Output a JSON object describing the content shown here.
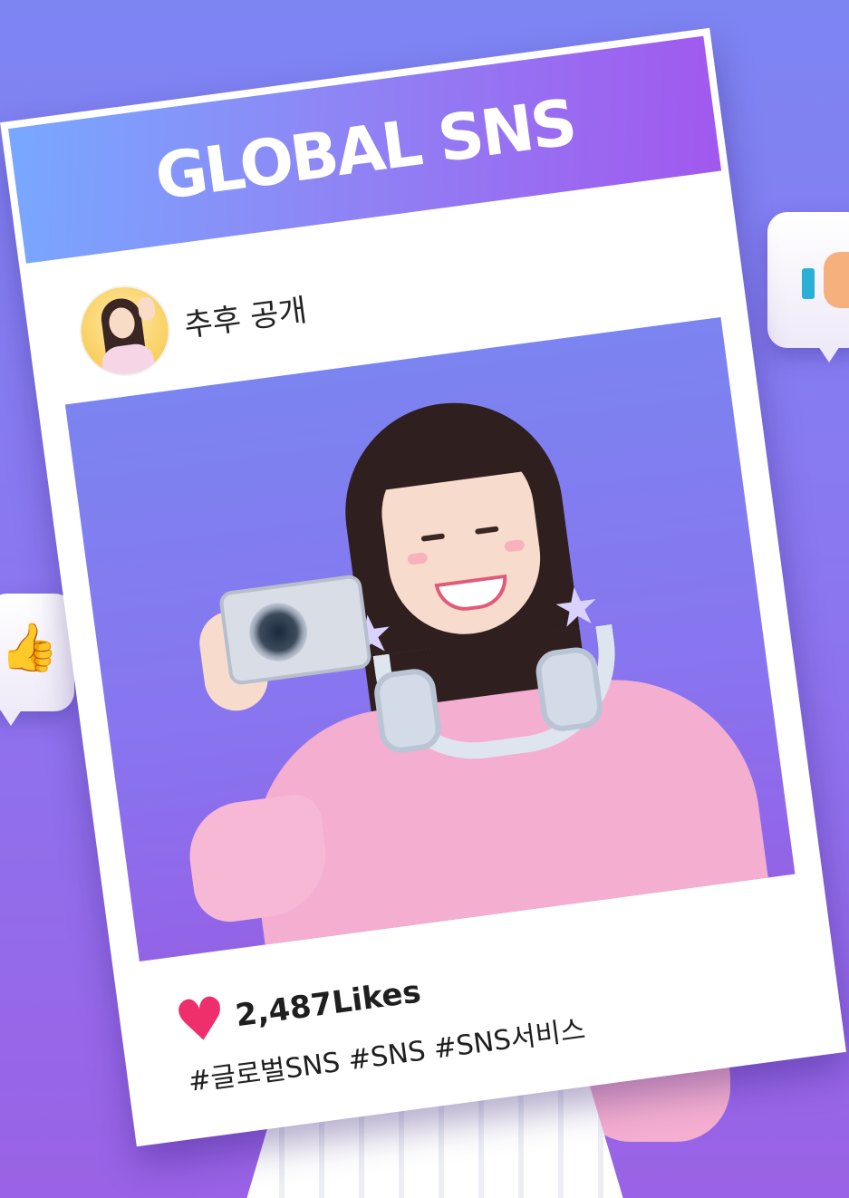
{
  "card": {
    "title": "GLOBAL SNS",
    "profile_name": "추후 공개",
    "likes": "2,487Likes",
    "hashtags": "#글로벌SNS #SNS #SNS서비스"
  },
  "icons": {
    "heart": "heart-icon",
    "thumbs_up_left": "thumbs-up-icon",
    "thumbs_up_right": "thumbs-up-icon"
  },
  "colors": {
    "background_top": "#7d85f3",
    "background_bottom": "#9a62e6",
    "header_gradient_start": "#78a8ff",
    "header_gradient_end": "#a158ee",
    "heart": "#ef2f6c",
    "card": "#ffffff"
  }
}
